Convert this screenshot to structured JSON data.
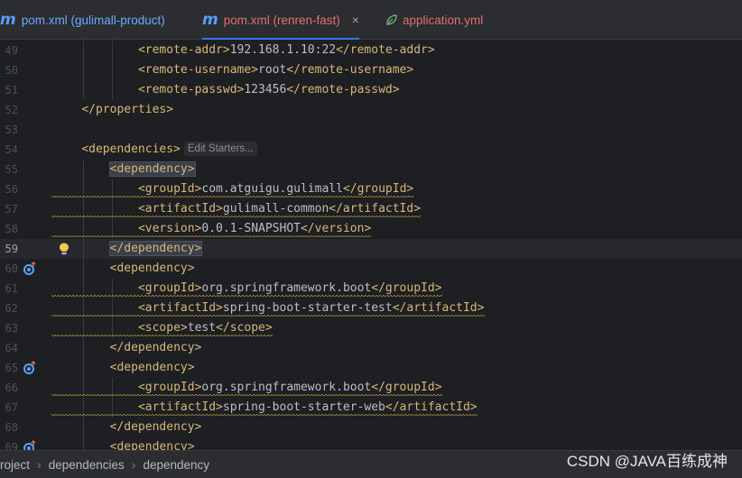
{
  "tabs": [
    {
      "icon": "m-icon",
      "label": "pom.xml (gulimall-product)",
      "active": false
    },
    {
      "icon": "m-icon",
      "label": "pom.xml (renren-fast)",
      "active": true,
      "close": "×"
    },
    {
      "icon": "leaf-icon",
      "label": "application.yml",
      "active": false
    }
  ],
  "editor": {
    "current_line": "59",
    "inlay_hint": "Edit Starters...",
    "lines": [
      {
        "num": "49",
        "indent": 4,
        "open": "<remote-addr>",
        "text": "192.168.1.10:22",
        "close": "</remote-addr>"
      },
      {
        "num": "50",
        "indent": 4,
        "open": "<remote-username>",
        "text": "root",
        "close": "</remote-username>"
      },
      {
        "num": "51",
        "indent": 4,
        "open": "<remote-passwd>",
        "text": "123456",
        "close": "</remote-passwd>"
      },
      {
        "num": "52",
        "indent": 2,
        "open": "</properties>",
        "text": "",
        "close": ""
      },
      {
        "num": "53",
        "indent": 0,
        "open": "",
        "text": "",
        "close": ""
      },
      {
        "num": "54",
        "indent": 2,
        "open": "<dependencies>",
        "text": "",
        "close": ""
      },
      {
        "num": "55",
        "indent": 3,
        "open": "<dependency>",
        "text": "",
        "close": ""
      },
      {
        "num": "56",
        "indent": 4,
        "open": "<groupId>",
        "text": "com.atguigu.gulimall",
        "close": "</groupId>"
      },
      {
        "num": "57",
        "indent": 4,
        "open": "<artifactId>",
        "text": "gulimall-common",
        "close": "</artifactId>"
      },
      {
        "num": "58",
        "indent": 4,
        "open": "<version>",
        "text": "0.0.1-SNAPSHOT",
        "close": "</version>"
      },
      {
        "num": "59",
        "indent": 3,
        "open": "</dependency>",
        "text": "",
        "close": ""
      },
      {
        "num": "60",
        "indent": 3,
        "open": "<dependency>",
        "text": "",
        "close": ""
      },
      {
        "num": "61",
        "indent": 4,
        "open": "<groupId>",
        "text": "org.springframework.boot",
        "close": "</groupId>"
      },
      {
        "num": "62",
        "indent": 4,
        "open": "<artifactId>",
        "text": "spring-boot-starter-test",
        "close": "</artifactId>"
      },
      {
        "num": "63",
        "indent": 4,
        "open": "<scope>",
        "text": "test",
        "close": "</scope>"
      },
      {
        "num": "64",
        "indent": 3,
        "open": "</dependency>",
        "text": "",
        "close": ""
      },
      {
        "num": "65",
        "indent": 3,
        "open": "<dependency>",
        "text": "",
        "close": ""
      },
      {
        "num": "66",
        "indent": 4,
        "open": "<groupId>",
        "text": "org.springframework.boot",
        "close": "</groupId>"
      },
      {
        "num": "67",
        "indent": 4,
        "open": "<artifactId>",
        "text": "spring-boot-starter-web",
        "close": "</artifactId>"
      },
      {
        "num": "68",
        "indent": 3,
        "open": "</dependency>",
        "text": "",
        "close": ""
      },
      {
        "num": "69",
        "indent": 3,
        "open": "<dependency>",
        "text": "",
        "close": ""
      }
    ]
  },
  "breadcrumbs": [
    "roject",
    "dependencies",
    "dependency"
  ],
  "watermark": "CSDN @JAVA百练成神",
  "colors": {
    "tag": "#d5b778",
    "text": "#bcbec4",
    "accent": "#3574f0",
    "warning": "#b8a340"
  }
}
